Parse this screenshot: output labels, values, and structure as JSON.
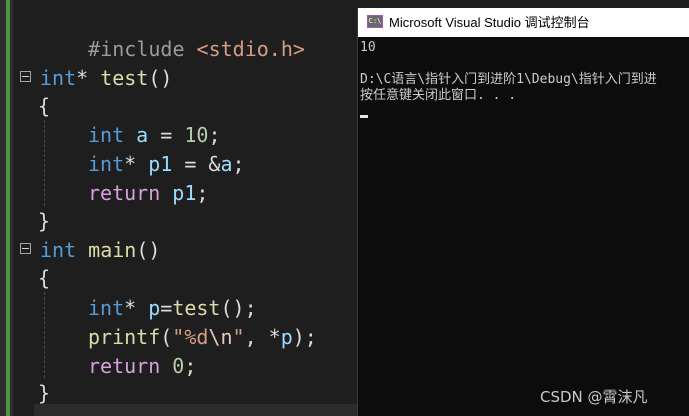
{
  "editor": {
    "include_line": {
      "directive": "#include",
      "header": "<stdio.h>"
    },
    "test_func": {
      "ret_type": "int",
      "ptr": "*",
      "name": "test",
      "parens": "()",
      "open_brace": "{",
      "close_brace": "}",
      "line1": {
        "type": "int",
        "var": "a",
        "eq": " = ",
        "num": "10",
        "end": ";"
      },
      "line2": {
        "type": "int",
        "ptr": "*",
        "var": "p1",
        "eq": " = &",
        "var2": "a",
        "end": ";"
      },
      "line3": {
        "kw": "return",
        "var": "p1",
        "end": ";"
      }
    },
    "main_func": {
      "ret_type": "int",
      "name": "main",
      "parens": "()",
      "open_brace": "{",
      "close_brace": "}",
      "line1": {
        "type": "int",
        "ptr": "*",
        "var": "p",
        "eq": "=",
        "fn": "test",
        "end": "();"
      },
      "line2": {
        "fn": "printf",
        "open": "(",
        "str1": "\"%d",
        "esc": "\\n",
        "str2": "\"",
        "comma": ", *",
        "var": "p",
        "end": ");"
      },
      "line3": {
        "kw": "return",
        "num": "0",
        "end": ";"
      }
    }
  },
  "console": {
    "icon_label": "C:\\",
    "title": "Microsoft Visual Studio 调试控制台",
    "lines": [
      "10",
      "",
      "D:\\C语言\\指针入门到进阶1\\Debug\\指针入门到进",
      "按任意键关闭此窗口. . ."
    ]
  },
  "watermark": "CSDN @霄沫凡"
}
